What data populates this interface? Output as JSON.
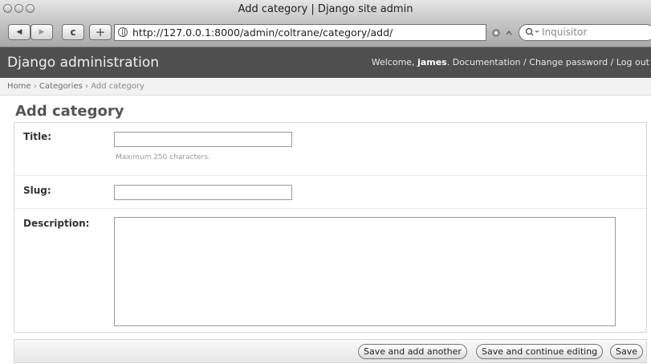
{
  "window": {
    "title": "Add category | Django site admin"
  },
  "browser": {
    "back_label": "◀",
    "forward_label": "▶",
    "reload_label": "c",
    "add_label": "+",
    "url": "http://127.0.0.1:8000/admin/coltrane/category/add/",
    "search_placeholder": "Inquisitor"
  },
  "header": {
    "brand": "Django administration",
    "welcome": "Welcome,",
    "user": "james",
    "documentation": "Documentation",
    "separator": "/",
    "change_password": "Change password",
    "logout": "Log out"
  },
  "breadcrumbs": {
    "home": "Home",
    "sep": "›",
    "categories": "Categories",
    "current": "Add category"
  },
  "page": {
    "title": "Add category"
  },
  "form": {
    "title_label": "Title:",
    "title_value": "",
    "title_help": "Maximum 250 characters.",
    "slug_label": "Slug:",
    "slug_value": "",
    "description_label": "Description:",
    "description_value": ""
  },
  "submit": {
    "save_add_another": "Save and add another",
    "save_continue": "Save and continue editing",
    "save": "Save"
  },
  "colors": {
    "header_bg": "#4f4f4f",
    "breadcrumb_bg": "#f2f2f2"
  }
}
